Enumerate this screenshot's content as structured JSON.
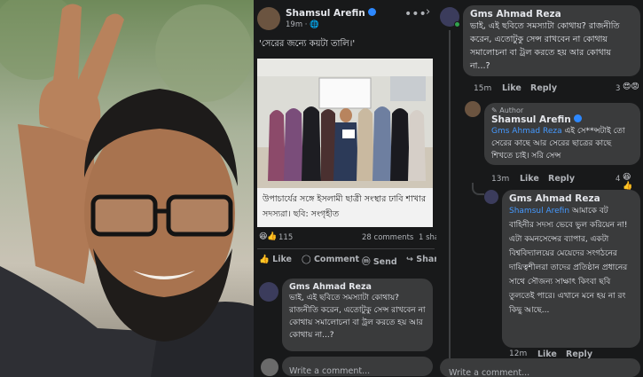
{
  "post": {
    "author": "Shamsul Arefin",
    "time": "19m",
    "text": "'সেরের জন্যে কয়টা তালি।'",
    "image_caption": "উপাচার্যের সঙ্গে ইসলামী ছাত্রী সংস্থার ঢাবি শাখার সদস্যরা। ছবি: সংগৃহীত",
    "reaction_count": "115",
    "comments_count": "28 comments",
    "shares_count": "1 sha",
    "actions": [
      "Like",
      "Comment",
      "Send",
      "Shar"
    ]
  },
  "mid_comment": {
    "author": "Gms Ahmad Reza",
    "text": "ভাই, এই ছবিতে সমস্যাটা কোথায়? রাজনীতি করেন, এতোটুকু সেন্স রাখবেন না কোথায় সমালোচনা বা ট্রল করতে হয় আর কোথায় না...?"
  },
  "write_comment_placeholder": "Write a comment...",
  "thread": {
    "comment1": {
      "author": "Gms Ahmad Reza",
      "text": "ভাই, এই ছবিতে সমস্যাটা কোথায়? রাজনীতি করেন, এতোটুকু সেন্স রাখবেন না কোথায় সমালোচনা বা ট্রল করতে হয় আর কোথায় না...?",
      "time": "15m",
      "like": "Like",
      "reply": "Reply",
      "reactions": "3"
    },
    "comment2": {
      "badge": "Author",
      "author": "Shamsul Arefin",
      "mention": "Gms Ahmad Reza",
      "text": " এই সে**ন্সটাই তো সেরের কাছে আর সেরের ছাত্রের কাছে শিখতে চাই। সরি সেন্স",
      "time": "13m",
      "like": "Like",
      "reply": "Reply",
      "reactions": "4"
    },
    "comment3": {
      "author": "Gms Ahmad Reza",
      "mention": "Shamsul Arefin",
      "text": " আমাকে বট বাহিনীর সদস্য ভেবে ভুল করিয়েন না! এটা কমনসেন্সের ব্যাপার, একটা বিশ্ববিদ্যালয়ের মেয়েদের সংগঠনের দায়িত্বশীলরা তাদের প্রতিষ্ঠান প্রধানের সাথে সৌজন্য সাক্ষাৎ কিংবা ছবি তুলতেই পারে। এখানে মনে হয় না রং কিছু আছে...",
      "time": "12m",
      "like": "Like",
      "reply": "Reply"
    }
  },
  "colors": {
    "bg": "#18191a",
    "bubble": "#3a3b3c",
    "mention": "#4599ff",
    "verified": "#2d88ff"
  }
}
